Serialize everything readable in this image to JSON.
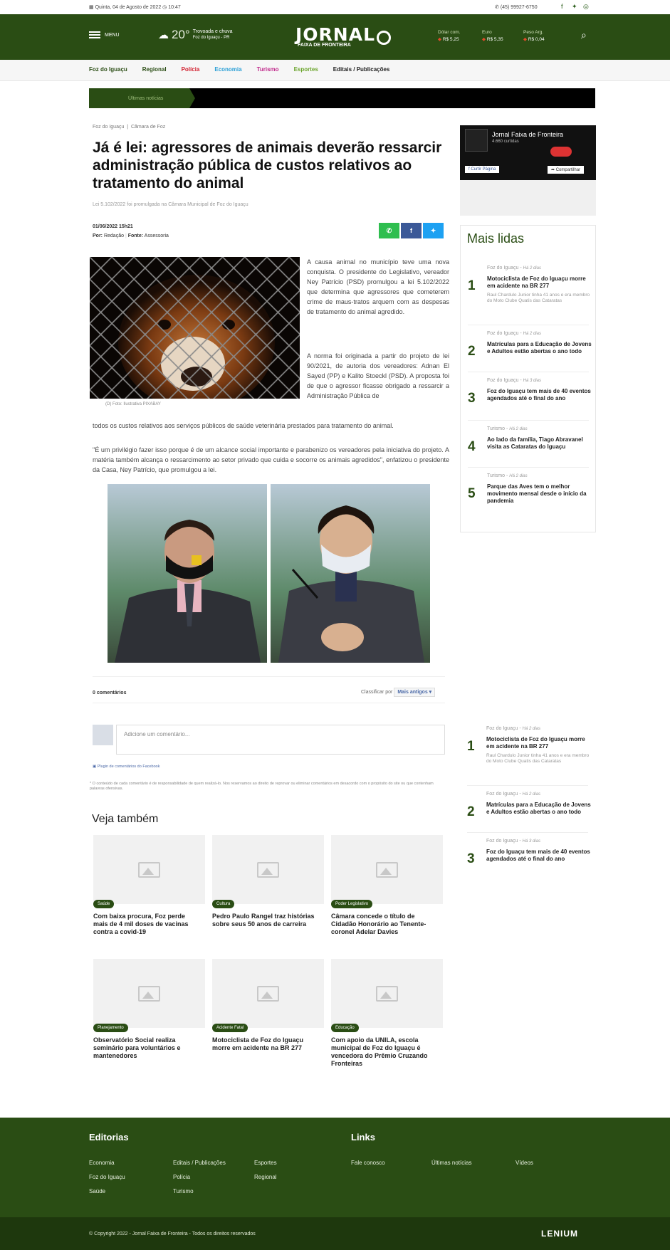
{
  "topbar": {
    "date": "Quinta, 04 de Agosto de 2022",
    "time": "10:47",
    "phone": "(45) 99927-6750"
  },
  "header": {
    "menu_label": "MENU",
    "temperature": "20°",
    "weather_desc": "Trovoada e chuva",
    "weather_city": "Foz do Iguaçu - PR",
    "logo_main": "JORNAL",
    "logo_sub": "FAIXA DE FRONTEIRA",
    "currencies": [
      {
        "name": "Dólar com.",
        "value": "R$ 5,25"
      },
      {
        "name": "Euro",
        "value": "R$ 5,35"
      },
      {
        "name": "Peso Arg.",
        "value": "R$ 0,04"
      }
    ]
  },
  "nav": [
    {
      "label": "Foz do Iguaçu",
      "color": "#2a4d14"
    },
    {
      "label": "Regional",
      "color": "#2a4d14"
    },
    {
      "label": "Polícia",
      "color": "#d2202f"
    },
    {
      "label": "Economia",
      "color": "#2a9fd6"
    },
    {
      "label": "Turismo",
      "color": "#c0298b"
    },
    {
      "label": "Esportes",
      "color": "#6aa42b"
    },
    {
      "label": "Editais / Publicações",
      "color": "#222222"
    }
  ],
  "ticker_label": "Últimas notícias",
  "article": {
    "crumb_1": "Foz do Iguaçu",
    "crumb_2": "Câmara de Foz",
    "title": "Já é lei: agressores de animais deverão ressarcir administração pública de custos relativos ao tratamento do animal",
    "subtitle": "Lei 5.102/2022 foi promulgada na Câmara Municipal de Foz do Iguaçu",
    "datetime": "01/06/2022 15h21",
    "author_label": "Por:",
    "author": "Redação",
    "source_label": "Fonte:",
    "source": "Assessoria",
    "photo_caption": "(D) Foto: Ilustrativa PIXABAY",
    "p1": "A causa animal no município teve uma nova conquista. O presidente do Legislativo, vereador Ney Patrício (PSD) promulgou a lei 5.102/2022 que determina que agressores que cometerem crime de maus-tratos arquem com as despesas de tratamento do animal agredido.",
    "p2a": "A norma foi originada a partir do projeto de lei 90/2021, de autoria dos vereadores: Adnan El Sayed (PP) e Kalito Stoeckl (PSD). A proposta foi de que o agressor ficasse obrigado a ressarcir a Administração Pública de",
    "p2b": "todos os custos relativos aos serviços públicos de saúde veterinária prestados para tratamento do animal.",
    "p3": "\"É um privilégio fazer isso porque é de um alcance social importante e parabenizo os vereadores pela iniciativa do projeto. A matéria também alcança o ressarcimento ao setor privado que cuida e socorre os animais agredidos\", enfatizou o presidente da Casa, Ney Patrício, que promulgou a lei."
  },
  "facebook_box": {
    "page_name": "Jornal Faixa de Fronteira",
    "likes": "4.660 curtidas",
    "like_button": "Curtir Página",
    "share_button": "Compartilhar"
  },
  "mais_lidas": {
    "title": "Mais lidas",
    "items": [
      {
        "num": "1",
        "cat": "Foz do Iguaçu",
        "ago": "Há 2 dias",
        "headline": "Motociclista de Foz do Iguaçu morre em acidente na BR 277",
        "excerpt": "Raul Chardulo Junior tinha 41 anos e era membro do Moto Clube Quatis das Cataratas"
      },
      {
        "num": "2",
        "cat": "Foz do Iguaçu",
        "ago": "Há 2 dias",
        "headline": "Matrículas para a Educação de Jovens e Adultos estão abertas o ano todo",
        "excerpt": ""
      },
      {
        "num": "3",
        "cat": "Foz do Iguaçu",
        "ago": "Há 3 dias",
        "headline": "Foz do Iguaçu tem mais de 40 eventos agendados até o final do ano",
        "excerpt": ""
      },
      {
        "num": "4",
        "cat": "Turismo",
        "ago": "Há 2 dias",
        "headline": "Ao lado da família, Tiago Abravanel visita as Cataratas do Iguaçu",
        "excerpt": ""
      },
      {
        "num": "5",
        "cat": "Turismo",
        "ago": "Há 2 dias",
        "headline": "Parque das Aves tem o melhor movimento mensal desde o início da pandemia",
        "excerpt": ""
      }
    ]
  },
  "comments": {
    "count": "0 comentários",
    "sort_label": "Classificar por",
    "sort_value": "Mais antigos",
    "placeholder": "Adicione um comentário...",
    "plugin": "Plugin de comentários do Facebook",
    "disclaimer": "* O conteúdo de cada comentário é de responsabilidade de quem realizá-lo. Nos reservamos ao direito de reprovar ou eliminar comentários em desacordo com o propósito do site ou que contenham palavras ofensivas."
  },
  "veja": {
    "title": "Veja também",
    "cards": [
      {
        "tag": "Saúde",
        "title": "Com baixa procura, Foz perde mais de 4 mil doses de vacinas contra a covid-19"
      },
      {
        "tag": "Cultura",
        "title": "Pedro Paulo Rangel traz histórias sobre seus 50 anos de carreira"
      },
      {
        "tag": "Poder Legislativo",
        "title": "Câmara concede o título de Cidadão Honorário ao Tenente-coronel Adelar Davies"
      },
      {
        "tag": "Planejamento",
        "title": "Observatório Social realiza seminário para voluntários e mantenedores"
      },
      {
        "tag": "Acidente Fatal",
        "title": "Motociclista de Foz do Iguaçu morre em acidente na BR 277"
      },
      {
        "tag": "Educação",
        "title": "Com apoio da UNILA, escola municipal de Foz do Iguaçu é vencedora do Prêmio Cruzando Fronteiras"
      }
    ]
  },
  "footer": {
    "editorias_title": "Editorias",
    "editorias": [
      "Economia",
      "Editais / Publicações",
      "Esportes",
      "Foz do Iguaçu",
      "Polícia",
      "Regional",
      "Saúde",
      "Turismo"
    ],
    "links_title": "Links",
    "links": [
      "Fale conosco",
      "Últimas notícias",
      "Vídeos"
    ],
    "copyright": "© Copyright 2022 - Jornal Faixa de Fronteira - Todos os direitos reservados",
    "brand": "LENIUM"
  }
}
